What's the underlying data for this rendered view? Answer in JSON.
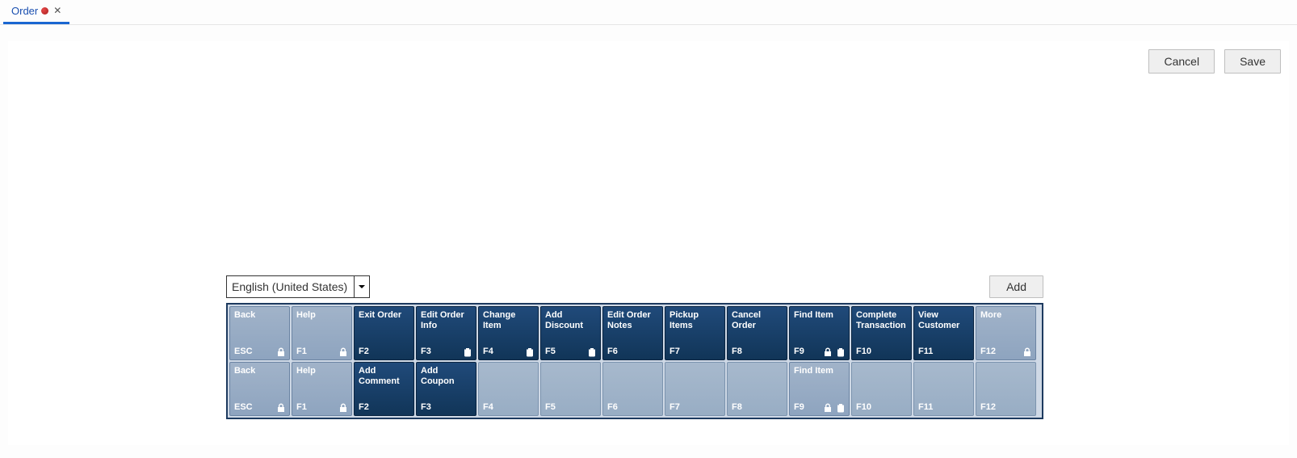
{
  "tab": {
    "label": "Order",
    "dirty": true
  },
  "buttons": {
    "cancel": "Cancel",
    "save": "Save",
    "add": "Add"
  },
  "language": {
    "selected": "English (United States)"
  },
  "rows": [
    [
      {
        "label": "Back",
        "fkey": "ESC",
        "style": "light",
        "interactable": true,
        "lock": true,
        "trash": false
      },
      {
        "label": "Help",
        "fkey": "F1",
        "style": "light",
        "interactable": true,
        "lock": true,
        "trash": false
      },
      {
        "label": "Exit Order",
        "fkey": "F2",
        "style": "dark",
        "interactable": true,
        "lock": false,
        "trash": false
      },
      {
        "label": "Edit Order\nInfo",
        "fkey": "F3",
        "style": "dark",
        "interactable": true,
        "lock": false,
        "trash": true
      },
      {
        "label": "Change Item",
        "fkey": "F4",
        "style": "dark",
        "interactable": true,
        "lock": false,
        "trash": true
      },
      {
        "label": "Add\nDiscount",
        "fkey": "F5",
        "style": "dark",
        "interactable": true,
        "lock": false,
        "trash": true
      },
      {
        "label": "Edit Order\nNotes",
        "fkey": "F6",
        "style": "dark",
        "interactable": true,
        "lock": false,
        "trash": false
      },
      {
        "label": "Pickup\nItems",
        "fkey": "F7",
        "style": "dark",
        "interactable": true,
        "lock": false,
        "trash": false
      },
      {
        "label": "Cancel\nOrder",
        "fkey": "F8",
        "style": "dark",
        "interactable": true,
        "lock": false,
        "trash": false
      },
      {
        "label": "Find Item",
        "fkey": "F9",
        "style": "dark",
        "interactable": true,
        "lock": true,
        "trash": true
      },
      {
        "label": "Complete\nTransaction",
        "fkey": "F10",
        "style": "dark",
        "interactable": true,
        "lock": false,
        "trash": false
      },
      {
        "label": "View\nCustomer",
        "fkey": "F11",
        "style": "dark",
        "interactable": true,
        "lock": false,
        "trash": false
      },
      {
        "label": "More",
        "fkey": "F12",
        "style": "light",
        "interactable": true,
        "lock": true,
        "trash": false
      }
    ],
    [
      {
        "label": "Back",
        "fkey": "ESC",
        "style": "light",
        "interactable": true,
        "lock": true,
        "trash": false
      },
      {
        "label": "Help",
        "fkey": "F1",
        "style": "light",
        "interactable": true,
        "lock": true,
        "trash": false
      },
      {
        "label": "Add\nComment",
        "fkey": "F2",
        "style": "dark",
        "interactable": true,
        "lock": false,
        "trash": false
      },
      {
        "label": "Add Coupon",
        "fkey": "F3",
        "style": "dark",
        "interactable": true,
        "lock": false,
        "trash": false
      },
      {
        "label": "",
        "fkey": "F4",
        "style": "empty",
        "interactable": false,
        "lock": false,
        "trash": false
      },
      {
        "label": "",
        "fkey": "F5",
        "style": "empty",
        "interactable": false,
        "lock": false,
        "trash": false
      },
      {
        "label": "",
        "fkey": "F6",
        "style": "empty",
        "interactable": false,
        "lock": false,
        "trash": false
      },
      {
        "label": "",
        "fkey": "F7",
        "style": "empty",
        "interactable": false,
        "lock": false,
        "trash": false
      },
      {
        "label": "",
        "fkey": "F8",
        "style": "empty",
        "interactable": false,
        "lock": false,
        "trash": false
      },
      {
        "label": "Find Item",
        "fkey": "F9",
        "style": "light",
        "interactable": true,
        "lock": true,
        "trash": true
      },
      {
        "label": "",
        "fkey": "F10",
        "style": "empty",
        "interactable": false,
        "lock": false,
        "trash": false
      },
      {
        "label": "",
        "fkey": "F11",
        "style": "empty",
        "interactable": false,
        "lock": false,
        "trash": false
      },
      {
        "label": "",
        "fkey": "F12",
        "style": "empty",
        "interactable": false,
        "lock": false,
        "trash": false
      }
    ]
  ]
}
